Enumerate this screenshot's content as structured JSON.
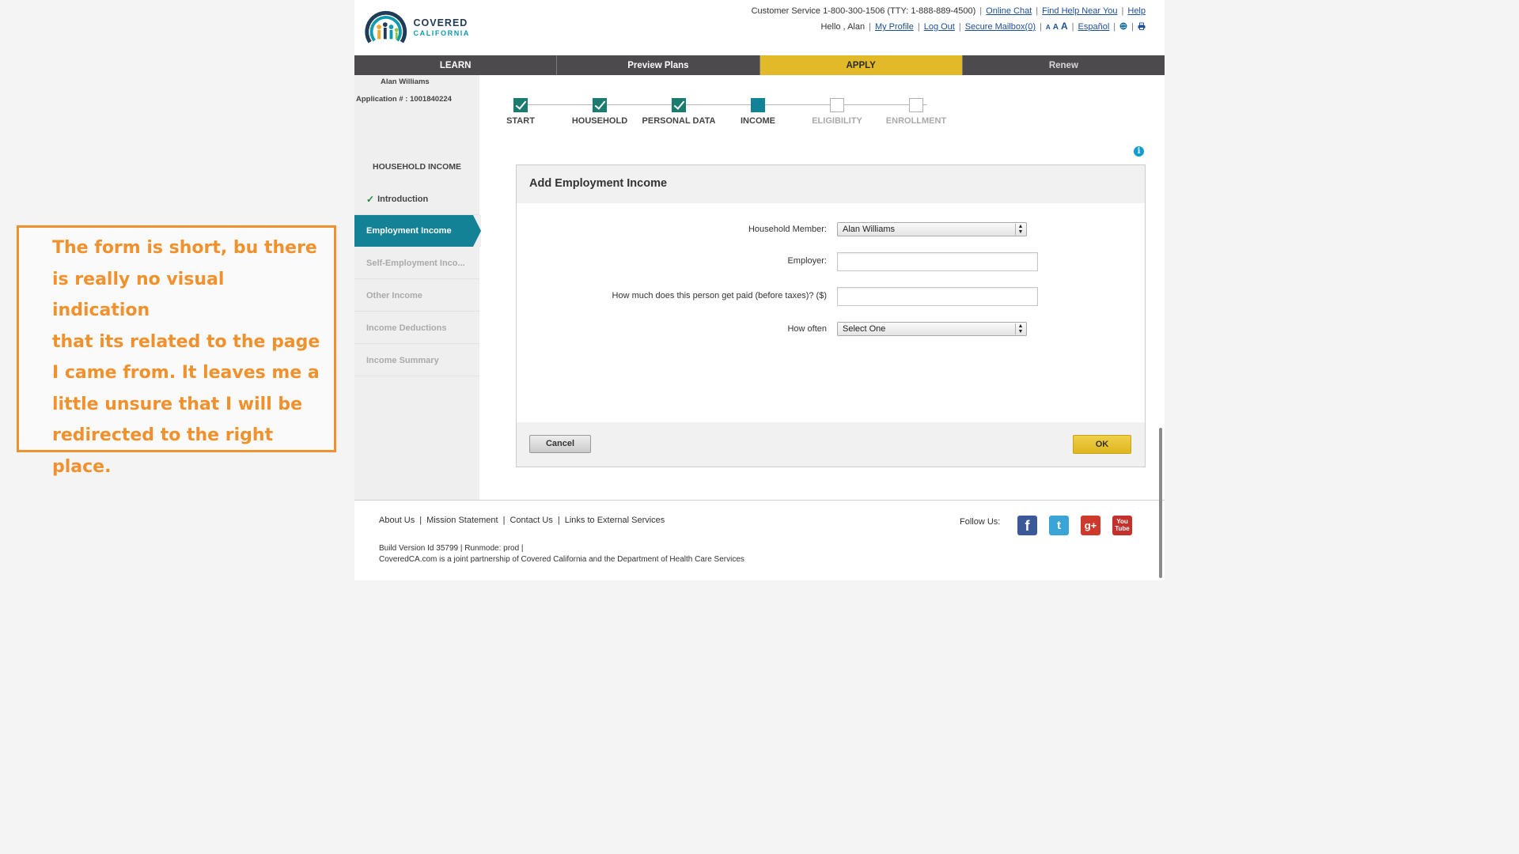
{
  "header": {
    "logo": {
      "line1": "COVERED",
      "line2": "CALIFORNIA"
    },
    "customer_service": "Customer Service 1-800-300-1506 (TTY: 1-888-889-4500)",
    "links_top": [
      "Online Chat",
      "Find Help Near You",
      "Help"
    ],
    "greeting": "Hello , Alan",
    "links_user": [
      "My Profile",
      "Log Out",
      "Secure Mailbox(0)"
    ],
    "font_sizes": [
      "A",
      "A",
      "A"
    ],
    "language": "Español",
    "icons": [
      "globe-icon",
      "print-icon"
    ]
  },
  "nav": {
    "tabs": [
      {
        "label": "LEARN",
        "active": false
      },
      {
        "label": "Preview Plans",
        "active": false
      },
      {
        "label": "APPLY",
        "active": true
      },
      {
        "label": "Renew",
        "active": false
      }
    ],
    "active_color": "#e2b928",
    "tab_color": "#4c4a4c"
  },
  "applicant": {
    "name": "Alan Williams",
    "application_number": "Application # : 1001840224"
  },
  "progress": {
    "steps": [
      {
        "label": "START",
        "state": "done"
      },
      {
        "label": "HOUSEHOLD",
        "state": "done"
      },
      {
        "label": "PERSONAL DATA",
        "state": "done"
      },
      {
        "label": "INCOME",
        "state": "current"
      },
      {
        "label": "ELIGIBILITY",
        "state": "future"
      },
      {
        "label": "ENROLLMENT",
        "state": "future"
      }
    ]
  },
  "sidebar": {
    "title": "HOUSEHOLD INCOME",
    "items": [
      {
        "label": "Introduction",
        "state": "done"
      },
      {
        "label": "Employment Income",
        "state": "active"
      },
      {
        "label": "Self-Employment Inco...",
        "state": "todo"
      },
      {
        "label": "Other Income",
        "state": "todo"
      },
      {
        "label": "Income Deductions",
        "state": "todo"
      },
      {
        "label": "Income Summary",
        "state": "todo"
      }
    ],
    "active_color": "#138196"
  },
  "form": {
    "title": "Add Employment Income",
    "household_member": {
      "label": "Household Member:",
      "value": "Alan Williams"
    },
    "employer": {
      "label": "Employer:",
      "value": ""
    },
    "pay": {
      "label": "How much does this person get paid (before taxes)? ($)",
      "value": ""
    },
    "frequency": {
      "label": "How often",
      "value": "Select One"
    },
    "cancel_label": "Cancel",
    "ok_label": "OK"
  },
  "footer": {
    "links": [
      "About Us",
      "Mission Statement",
      "Contact Us",
      "Links to External Services"
    ],
    "build": "Build Version Id 35799  |   Runmode: prod  |",
    "partnership": "CoveredCA.com is a joint partnership of Covered California and the Department of Health Care Services",
    "follow_label": "Follow Us:",
    "social": [
      {
        "name": "facebook-icon",
        "glyph": "f"
      },
      {
        "name": "twitter-icon",
        "glyph": "t"
      },
      {
        "name": "google-plus-icon",
        "glyph": "g+"
      },
      {
        "name": "youtube-icon",
        "glyph": "You Tube"
      }
    ]
  },
  "annotation": {
    "lines": [
      "The form is short, bu there",
      "is really no visual indication",
      "that its related to the page",
      "I came from. It leaves me a",
      "little unsure that I will be",
      "redirected to the right",
      "place."
    ],
    "color": "#f0912d"
  }
}
